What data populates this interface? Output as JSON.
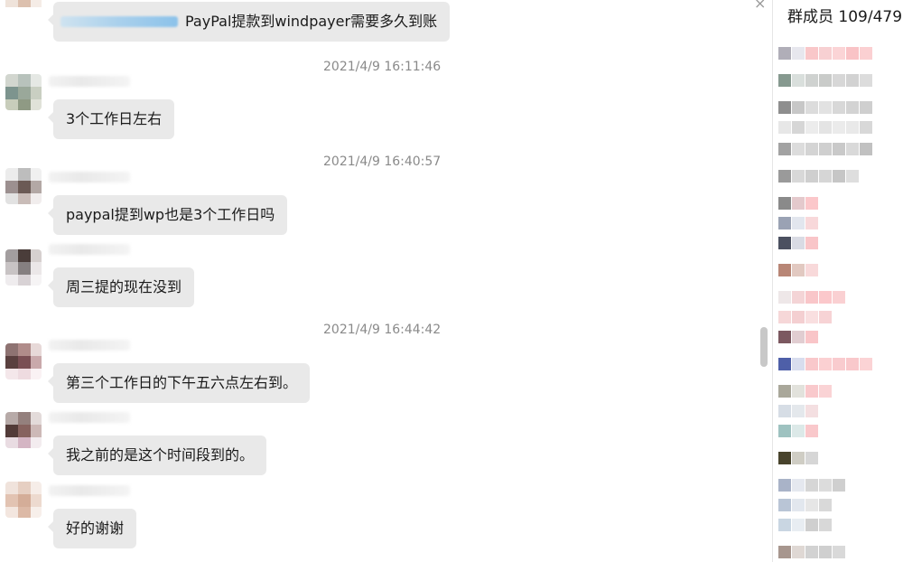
{
  "chat": {
    "first_message": "PayPal提款到windpayer需要多久到账",
    "messages": [
      {
        "time": "2021/4/9 16:11:46",
        "text": "3个工作日左右"
      },
      {
        "time": "2021/4/9 16:40:57",
        "text": "paypal提到wp也是3个工作日吗"
      },
      {
        "time": "",
        "text": "周三提的现在没到"
      },
      {
        "time": "2021/4/9 16:44:42",
        "text": "第三个工作日的下午五六点左右到。"
      },
      {
        "time": "",
        "text": "我之前的是这个时间段到的。"
      },
      {
        "time": "",
        "text": "好的谢谢"
      }
    ]
  },
  "members_panel": {
    "title": "群成员 109/479"
  },
  "close_icon": "×",
  "colors": {
    "bubble": "#e9e9e9",
    "timestamp": "#8a8a8a",
    "background": "#ffffff"
  }
}
